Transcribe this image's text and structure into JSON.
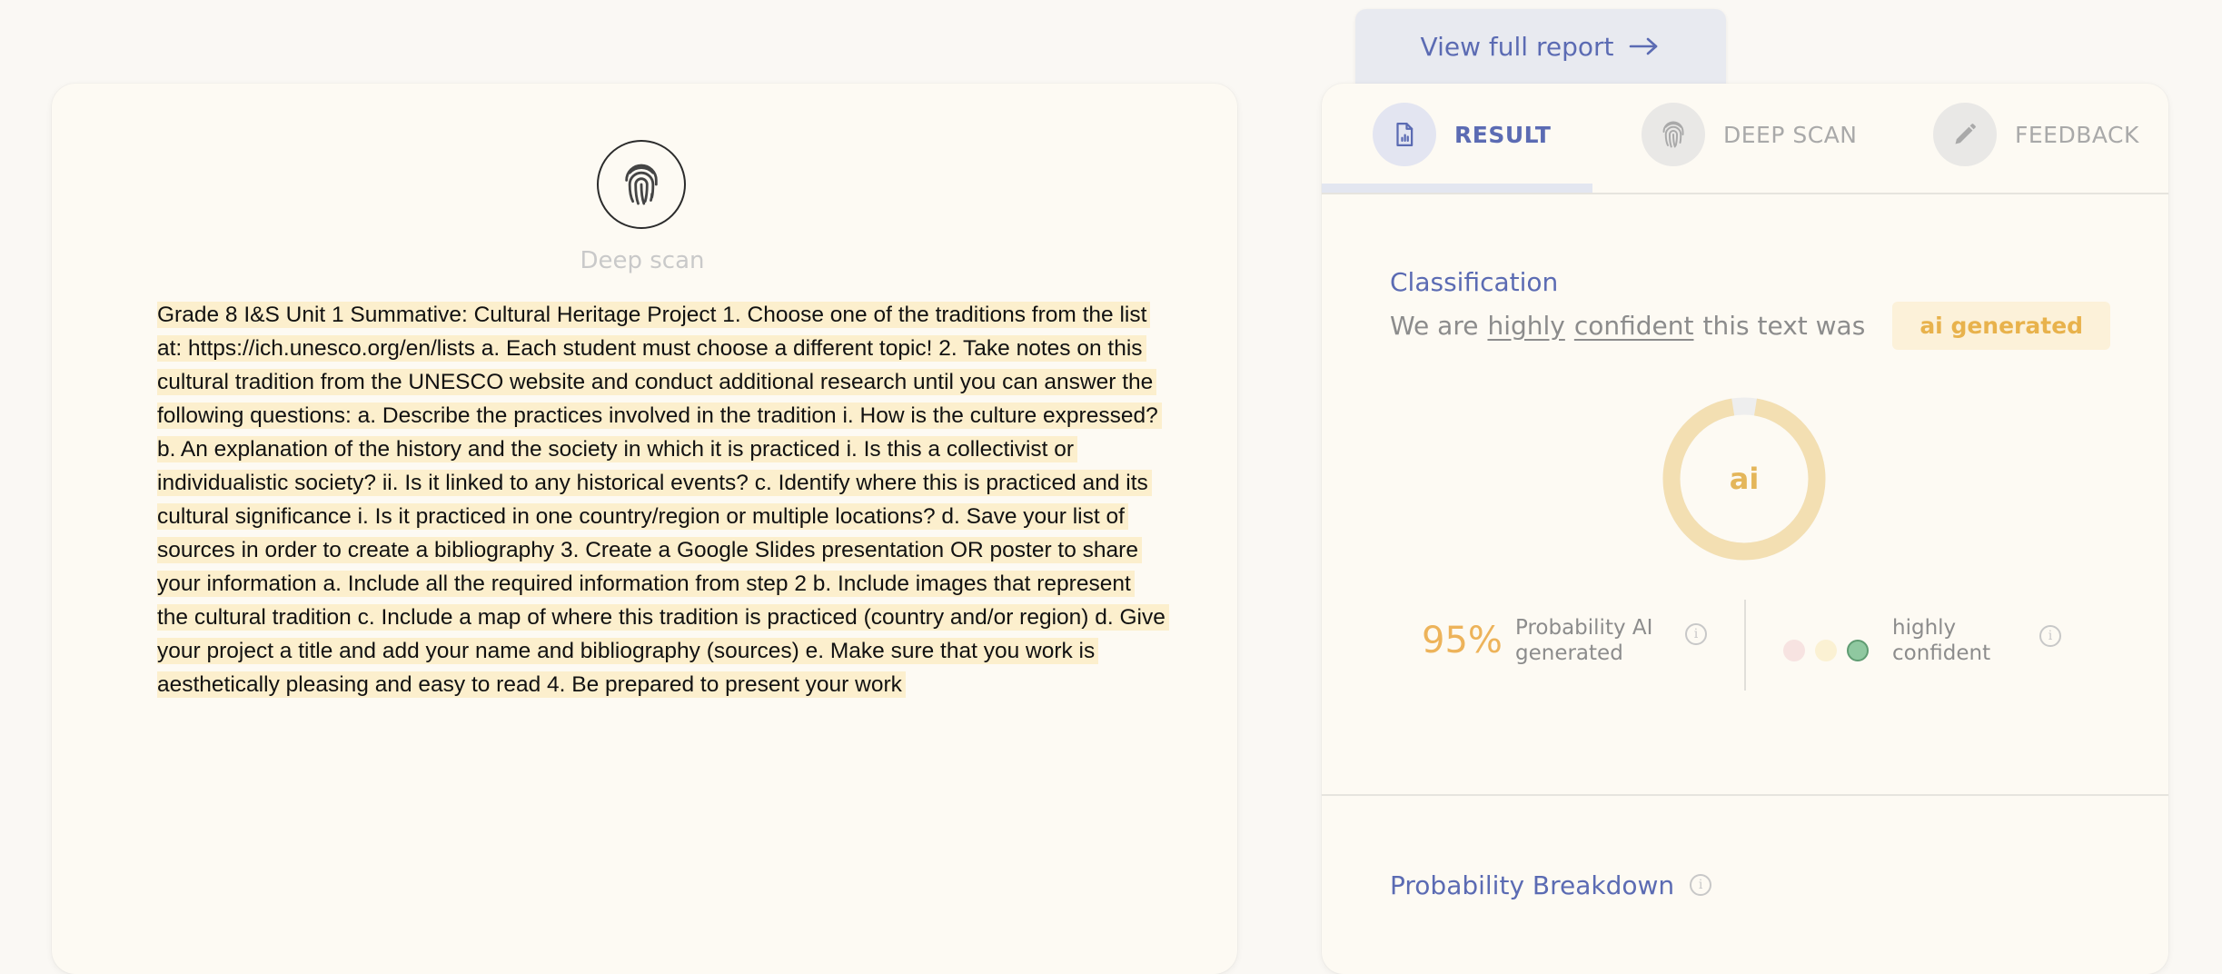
{
  "report_button": {
    "label": "View full report",
    "icon": "arrow-right-icon"
  },
  "deep_scan": {
    "icon": "fingerprint-icon",
    "label": "Deep scan"
  },
  "document": {
    "text": "Grade 8 I&S Unit 1 Summative: Cultural Heritage Project 1. Choose one of the traditions from the list at: https://ich.unesco.org/en/lists a. Each student must choose a different topic! 2. Take notes on this cultural tradition from the UNESCO website and conduct additional research until you can answer the following questions: a. Describe the practices involved in the tradition i. How is the culture expressed? b. An explanation of the history and the society in which it is practiced i. Is this a collectivist or individualistic society? ii. Is it linked to any historical events? c. Identify where this is practiced and its cultural significance i. Is it practiced in one country/region or multiple locations? d. Save your list of sources in order to create a bibliography 3. Create a Google Slides presentation OR poster to share your information a. Include all the required information from step 2 b. Include images that represent the cultural tradition c. Include a map of where this tradition is practiced (country and/or region) d. Give your project a title and add your name and bibliography (sources) e. Make sure that you work is aesthetically pleasing and easy to read 4. Be prepared to present your work",
    "highlight_color": "#fcefcd"
  },
  "tabs": [
    {
      "label": "RESULT",
      "icon": "document-chart-icon",
      "active": true
    },
    {
      "label": "DEEP SCAN",
      "icon": "fingerprint-icon",
      "active": false
    },
    {
      "label": "FEEDBACK",
      "icon": "pencil-icon",
      "active": false
    }
  ],
  "classification": {
    "title": "Classification",
    "prefix": "We are",
    "word1": "highly",
    "word2": "confident",
    "suffix": "this text was",
    "badge": "ai generated",
    "donut_label": "ai",
    "ai_fraction": 0.95,
    "probability": "95%",
    "probability_label": "Probability AI generated",
    "confidence_label": "highly confident",
    "confidence_dots": [
      {
        "color": "#f7e3e1",
        "active": false
      },
      {
        "color": "#fbf1d3",
        "active": false
      },
      {
        "color": "#8fc8a0",
        "active": true
      }
    ]
  },
  "breakdown": {
    "title": "Probability Breakdown"
  },
  "colors": {
    "accent": "#5b6bb3",
    "ai_amber": "#e8b24c",
    "donut_ring": "#f3dfb2",
    "donut_remainder": "#eeeeee"
  }
}
